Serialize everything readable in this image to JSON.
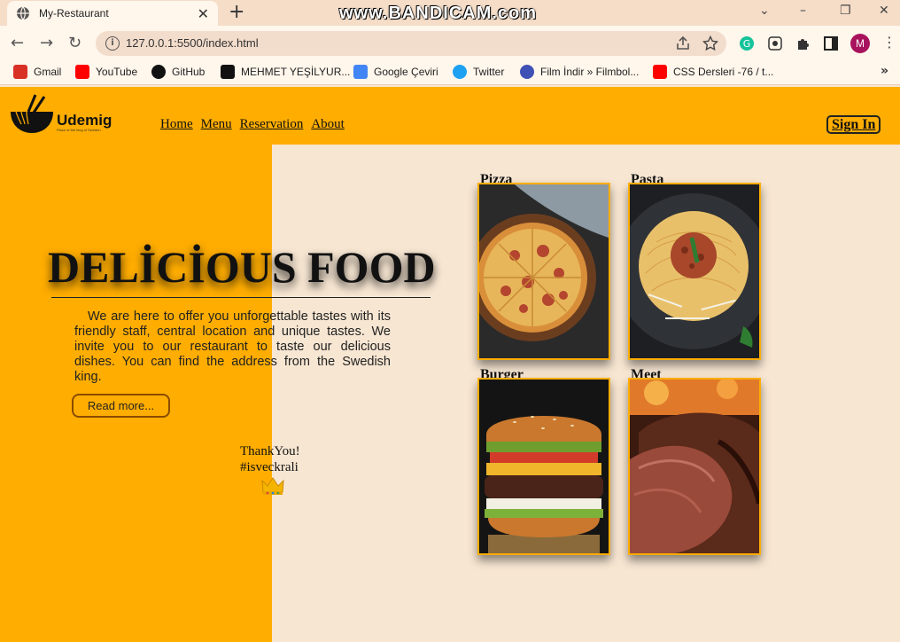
{
  "browser": {
    "tab_title": "My-Restaurant",
    "watermark": "www.BANDICAM.com",
    "url": "127.0.0.1:5500/index.html",
    "avatar_letter": "M",
    "bookmarks": [
      {
        "label": "Gmail",
        "icon": "gmail-icon",
        "color": "#d93025"
      },
      {
        "label": "YouTube",
        "icon": "youtube-icon",
        "color": "#ff0000"
      },
      {
        "label": "GitHub",
        "icon": "github-icon",
        "color": "#111111"
      },
      {
        "label": "MEHMET YEŞİLYUR...",
        "icon": "medium-icon",
        "color": "#111111"
      },
      {
        "label": "Google Çeviri",
        "icon": "google-translate-icon",
        "color": "#4285f4"
      },
      {
        "label": "Twitter",
        "icon": "twitter-icon",
        "color": "#1da1f2"
      },
      {
        "label": "Film İndir » Filmbol...",
        "icon": "film-icon",
        "color": "#3f51b5"
      },
      {
        "label": "CSS Dersleri -76 / t...",
        "icon": "youtube-icon",
        "color": "#ff0000"
      }
    ]
  },
  "site": {
    "logo": {
      "name": "Udemig",
      "tagline": "Place of the king of Sweden"
    },
    "nav": [
      "Home",
      "Menu",
      "Reservation",
      "About"
    ],
    "sign_in": "Sign In",
    "hero_title": "DELİCİOUS FOOD",
    "hero_text": "We are here to offer you unforgettable tastes with its friendly staff, central location and unique tastes. We invite you to our restaurant to taste our delicious dishes. You can find the address from the Swedish king.",
    "read_more": "Read more...",
    "thanks": "ThankYou!",
    "hashtag": "#isveckrali",
    "menu_cards": [
      "Pizza",
      "Pasta",
      "Burger",
      "Meet"
    ],
    "colors": {
      "accent": "#ffad00",
      "background": "#f7e6d2"
    }
  }
}
